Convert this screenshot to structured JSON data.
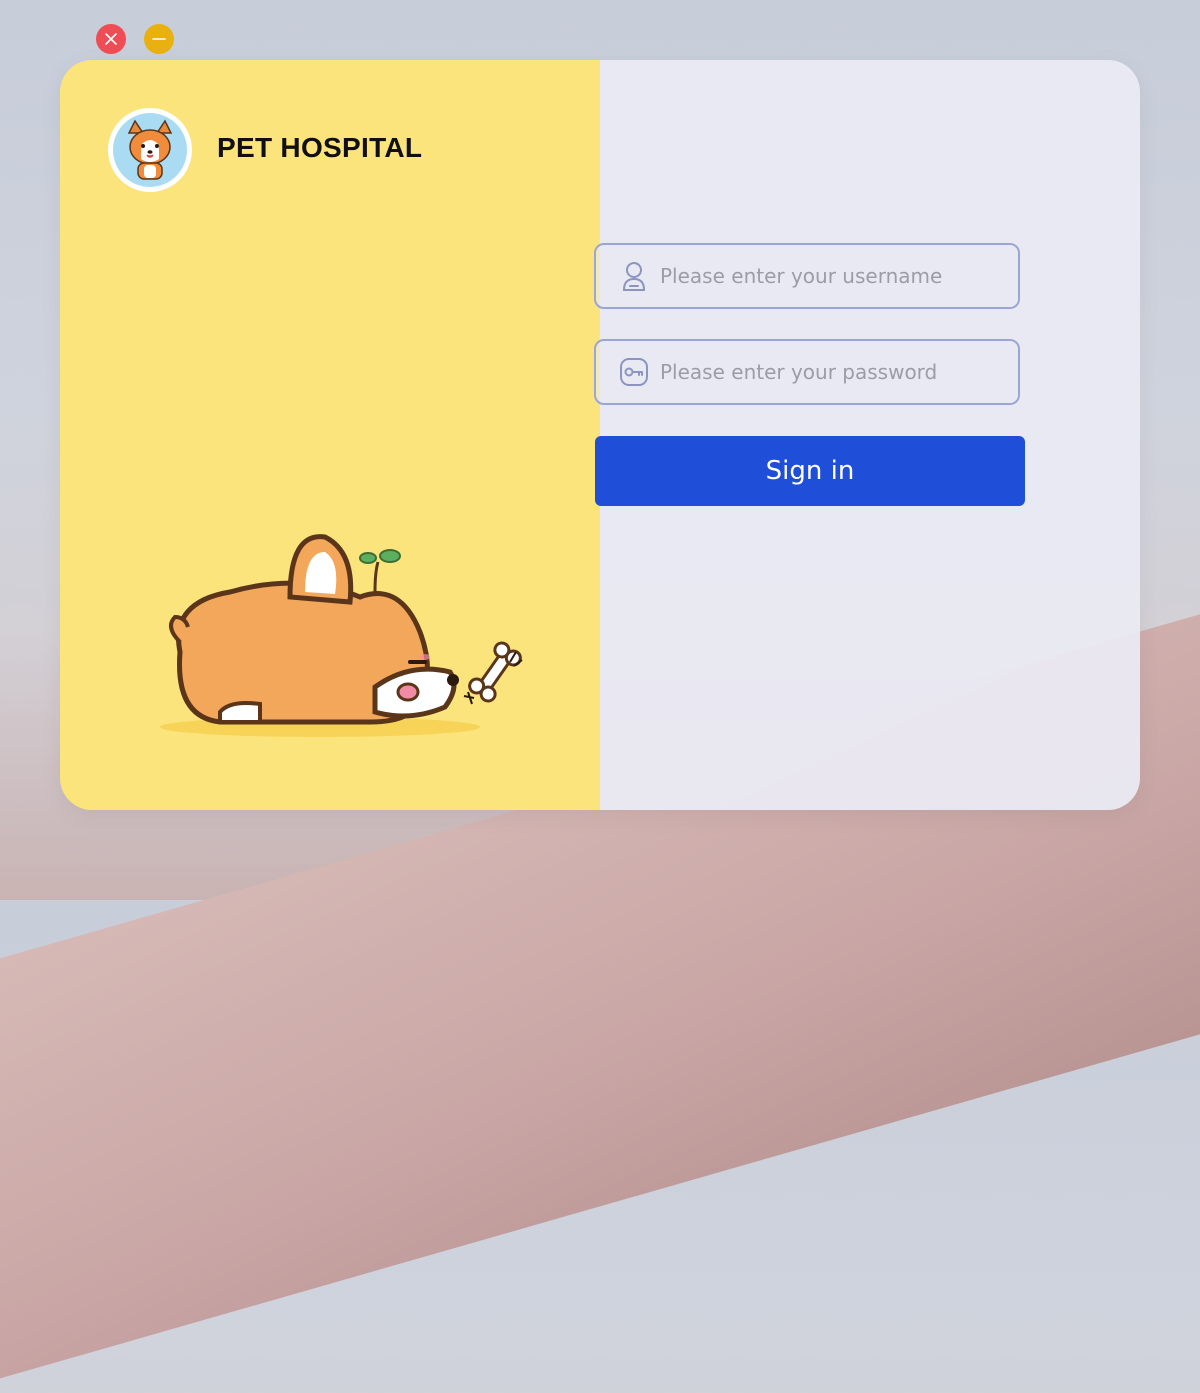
{
  "window": {
    "close_icon": "close-icon",
    "minimize_icon": "minimize-icon",
    "colors": {
      "close": "#ee4d55",
      "minimize": "#e8b10f"
    }
  },
  "brand": {
    "title": "PET HOSPITAL",
    "logo_icon": "corgi-avatar",
    "panel_color": "#fbe47c"
  },
  "illustration": {
    "icon": "sleeping-corgi-with-bone"
  },
  "login": {
    "username_placeholder": "Please enter your username",
    "username_icon": "user-icon",
    "password_placeholder": "Please enter your password",
    "password_icon": "key-icon",
    "signin_label": "Sign in",
    "accent": "#1f4fd8"
  }
}
